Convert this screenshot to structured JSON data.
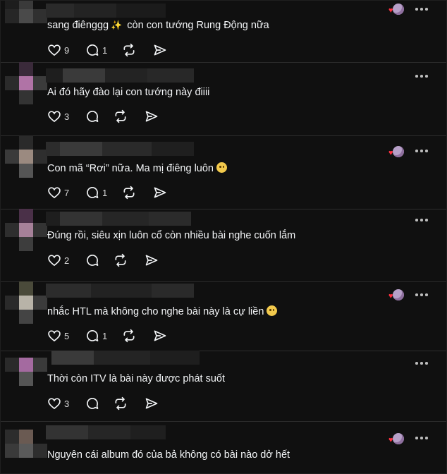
{
  "colors": {
    "background": "#101010",
    "text": "#f3f5f7",
    "muted": "#d8d8d8",
    "divider": "#2c2c2c",
    "heart": "#ff3040",
    "emoji": "#f2c94c"
  },
  "icons": {
    "like": "heart-outline-icon",
    "reply": "speech-bubble-icon",
    "repost": "repost-arrows-icon",
    "share": "paper-plane-icon",
    "more": "three-dots-icon",
    "reaction": "liked-by-author-icon",
    "sparkle": "sparkles-emoji",
    "pleading": "pleading-face-emoji",
    "grimace": "neutral-face-emoji"
  },
  "posts": [
    {
      "text_before": "sang điênggg",
      "text_after": " còn con tướng Rung Động nữa",
      "likes": "9",
      "replies": "1"
    },
    {
      "text": "Ai đó hãy đào lại con tướng này điiii",
      "likes": "3",
      "replies": ""
    },
    {
      "text": "Con mã “Rơi” nữa. Ma mị điêng luôn",
      "likes": "7",
      "replies": "1"
    },
    {
      "text": "Đúng rồi, siêu xịn luôn cổ còn nhiều bài nghe cuốn lắm",
      "likes": "2",
      "replies": ""
    },
    {
      "text": "nhắc HTL mà không cho nghe bài này là cự liền",
      "likes": "5",
      "replies": "1"
    },
    {
      "text": "Thời còn ITV là bài này được phát suốt",
      "likes": "3",
      "replies": ""
    },
    {
      "text": "Nguyên cái album đó của bả không có bài nào dở hết",
      "likes": "",
      "replies": ""
    }
  ]
}
